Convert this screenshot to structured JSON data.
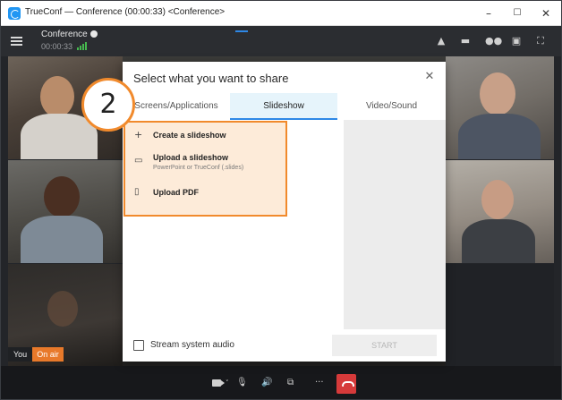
{
  "window": {
    "title": "TrueConf — Conference (00:00:33) <Conference>",
    "controls": [
      "–",
      "☐",
      "✕"
    ]
  },
  "header": {
    "conference_name": "Conference",
    "timer": "00:00:33",
    "icons": [
      "bell-icon",
      "chat-icon",
      "participants-icon",
      "slides-icon",
      "fullscreen-icon"
    ]
  },
  "self_view": {
    "you_label": "You",
    "on_air_label": "On air"
  },
  "dialog": {
    "title": "Select what you want to share",
    "close_icon": "close-icon",
    "tabs": [
      {
        "label": "Screens/Applications"
      },
      {
        "label": "Slideshow",
        "active": true
      },
      {
        "label": "Video/Sound"
      }
    ],
    "menu": {
      "create": {
        "label": "Create a slideshow",
        "icon": "plus-icon"
      },
      "upload": {
        "label": "Upload a slideshow",
        "sub": "PowerPoint or TrueConf (.slides)",
        "icon": "folder-icon"
      },
      "pdf": {
        "label": "Upload PDF",
        "icon": "pdf-file-icon"
      }
    },
    "stream_audio_label": "Stream system audio",
    "stream_audio_checked": false,
    "start_label": "START"
  },
  "step_marker": {
    "number": "2"
  },
  "controlbar": {
    "icons": [
      "camera-icon",
      "microphone-icon",
      "speaker-icon",
      "share-screen-icon",
      "more-icon",
      "hangup-icon"
    ],
    "more_glyph": "···"
  },
  "colors": {
    "accent": "#2e88e6",
    "highlight_border": "#f18a2c",
    "highlight_fill": "#fdebd9",
    "on_air": "#e8792a",
    "hangup": "#d63a3a",
    "signal": "#46b94f"
  }
}
